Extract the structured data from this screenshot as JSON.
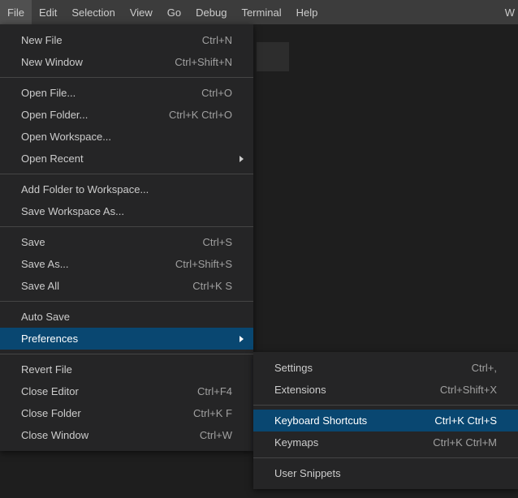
{
  "menubar": {
    "items": [
      "File",
      "Edit",
      "Selection",
      "View",
      "Go",
      "Debug",
      "Terminal",
      "Help"
    ],
    "rightText": "W"
  },
  "fileMenu": {
    "groups": [
      [
        {
          "label": "New File",
          "accel": "Ctrl+N"
        },
        {
          "label": "New Window",
          "accel": "Ctrl+Shift+N"
        }
      ],
      [
        {
          "label": "Open File...",
          "accel": "Ctrl+O"
        },
        {
          "label": "Open Folder...",
          "accel": "Ctrl+K Ctrl+O"
        },
        {
          "label": "Open Workspace...",
          "accel": ""
        },
        {
          "label": "Open Recent",
          "accel": "",
          "submenu": true
        }
      ],
      [
        {
          "label": "Add Folder to Workspace...",
          "accel": ""
        },
        {
          "label": "Save Workspace As...",
          "accel": ""
        }
      ],
      [
        {
          "label": "Save",
          "accel": "Ctrl+S"
        },
        {
          "label": "Save As...",
          "accel": "Ctrl+Shift+S"
        },
        {
          "label": "Save All",
          "accel": "Ctrl+K S"
        }
      ],
      [
        {
          "label": "Auto Save",
          "accel": ""
        },
        {
          "label": "Preferences",
          "accel": "",
          "submenu": true,
          "highlighted": true
        }
      ],
      [
        {
          "label": "Revert File",
          "accel": ""
        },
        {
          "label": "Close Editor",
          "accel": "Ctrl+F4"
        },
        {
          "label": "Close Folder",
          "accel": "Ctrl+K F"
        },
        {
          "label": "Close Window",
          "accel": "Ctrl+W"
        }
      ]
    ]
  },
  "preferencesMenu": {
    "groups": [
      [
        {
          "label": "Settings",
          "accel": "Ctrl+,"
        },
        {
          "label": "Extensions",
          "accel": "Ctrl+Shift+X"
        }
      ],
      [
        {
          "label": "Keyboard Shortcuts",
          "accel": "Ctrl+K Ctrl+S",
          "highlighted": true
        },
        {
          "label": "Keymaps",
          "accel": "Ctrl+K Ctrl+M"
        }
      ],
      [
        {
          "label": "User Snippets",
          "accel": ""
        }
      ]
    ]
  }
}
